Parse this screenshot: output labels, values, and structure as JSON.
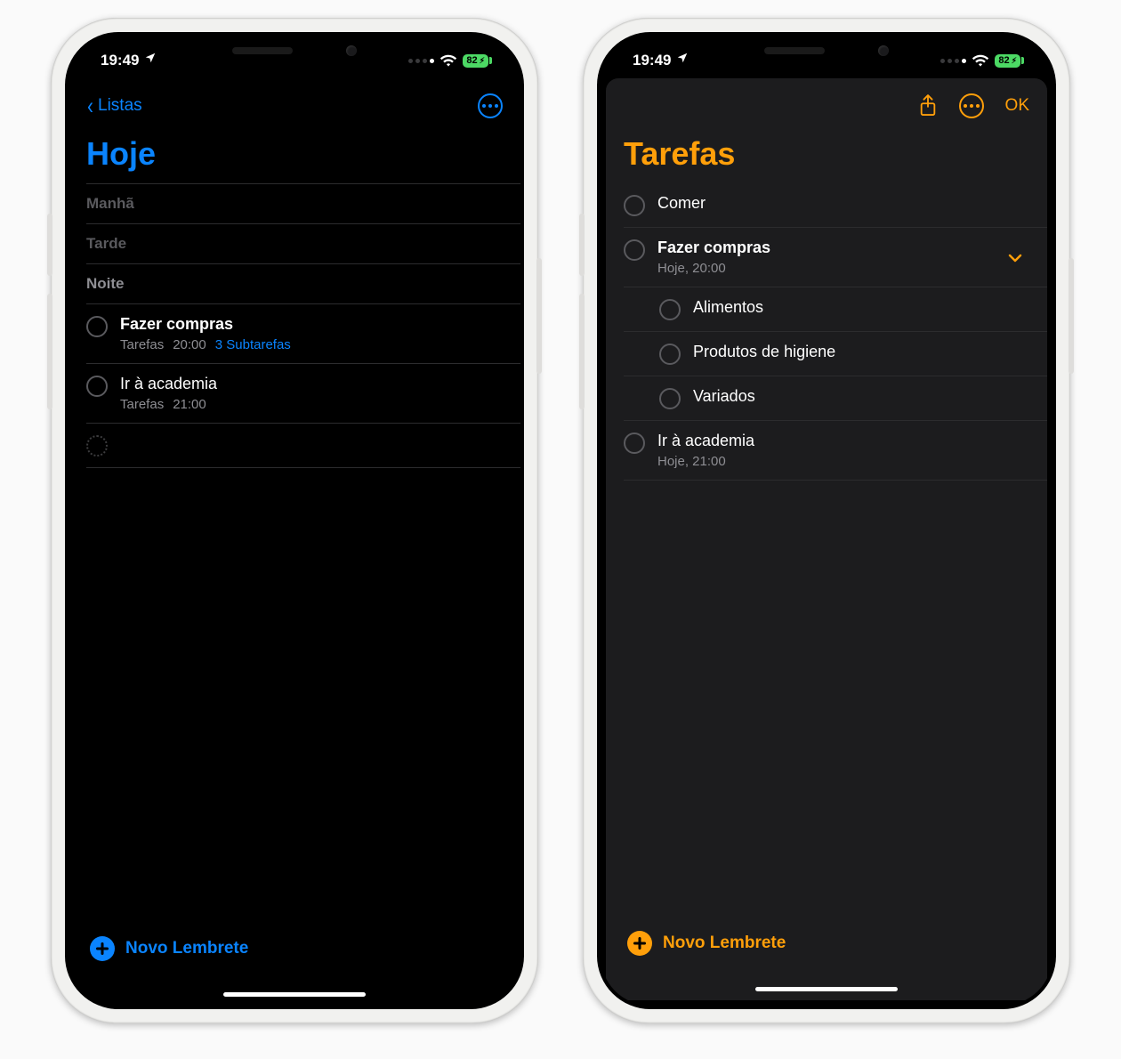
{
  "status": {
    "time": "19:49",
    "battery": "82",
    "signal_active_bars": 1,
    "signal_total_bars": 4
  },
  "screen1": {
    "back_label": "Listas",
    "title": "Hoje",
    "sections": {
      "morning": "Manhã",
      "afternoon": "Tarde",
      "night": "Noite"
    },
    "reminders": [
      {
        "title": "Fazer compras",
        "list": "Tarefas",
        "time": "20:00",
        "subtasks_label": "3 Subtarefas"
      },
      {
        "title": "Ir à academia",
        "list": "Tarefas",
        "time": "21:00"
      }
    ],
    "add_label": "Novo Lembrete"
  },
  "screen2": {
    "title": "Tarefas",
    "ok_label": "OK",
    "reminders": [
      {
        "title": "Comer"
      },
      {
        "title": "Fazer compras",
        "due": "Hoje, 20:00",
        "expanded": true,
        "subtasks": [
          "Alimentos",
          "Produtos de higiene",
          "Variados"
        ]
      },
      {
        "title": "Ir à academia",
        "due": "Hoje, 21:00"
      }
    ],
    "add_label": "Novo Lembrete"
  }
}
